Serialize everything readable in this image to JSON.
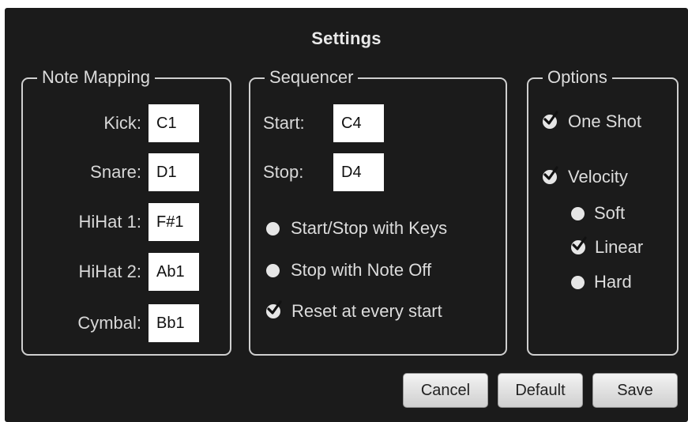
{
  "dialog": {
    "title": "Settings"
  },
  "note_mapping": {
    "legend": "Note Mapping",
    "rows": [
      {
        "label": "Kick:",
        "value": "C1"
      },
      {
        "label": "Snare:",
        "value": "D1"
      },
      {
        "label": "HiHat 1:",
        "value": "F#1"
      },
      {
        "label": "HiHat 2:",
        "value": "Ab1"
      },
      {
        "label": "Cymbal:",
        "value": "Bb1"
      }
    ]
  },
  "sequencer": {
    "legend": "Sequencer",
    "start_label": "Start:",
    "start_value": "C4",
    "stop_label": "Stop:",
    "stop_value": "D4",
    "options": [
      {
        "label": "Start/Stop with Keys",
        "checked": false
      },
      {
        "label": "Stop with Note Off",
        "checked": false
      },
      {
        "label": "Reset at every start",
        "checked": true
      }
    ]
  },
  "options": {
    "legend": "Options",
    "one_shot": {
      "label": "One Shot",
      "checked": true
    },
    "velocity": {
      "label": "Velocity",
      "checked": true
    },
    "velocity_modes": [
      {
        "label": "Soft",
        "checked": false
      },
      {
        "label": "Linear",
        "checked": true
      },
      {
        "label": "Hard",
        "checked": false
      }
    ]
  },
  "buttons": {
    "cancel": "Cancel",
    "default": "Default",
    "save": "Save"
  }
}
